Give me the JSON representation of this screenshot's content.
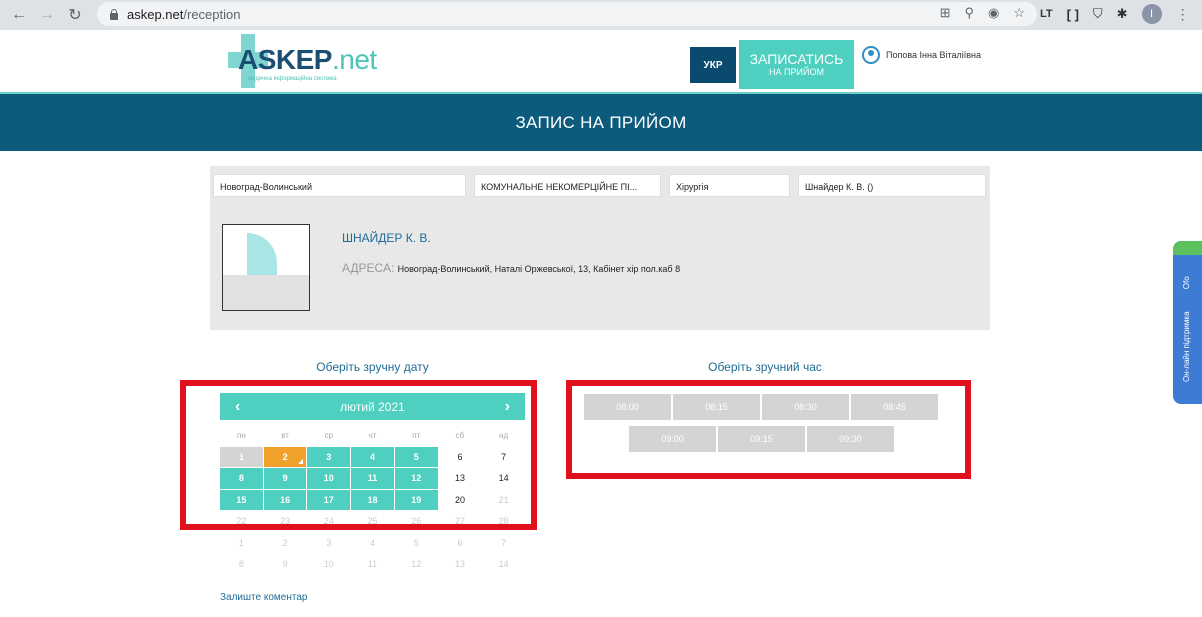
{
  "browser": {
    "url_host": "askep.net",
    "url_path": "/reception",
    "profile_initial": "I"
  },
  "header": {
    "logo_text": "ASKEP",
    "logo_net": ".net",
    "logo_tagline": "медична інформаційна система",
    "lang_label": "УКР",
    "book_label_line1": "ЗАПИСАТИСЬ",
    "book_label_line2": "НА ПРИЙОМ",
    "user_name": "Попова Інна Віталіївна"
  },
  "banner": {
    "title": "ЗАПИС НА ПРИЙОМ"
  },
  "filters": {
    "city": "Новоград-Волинський",
    "institution": "КОМУНАЛЬНЕ НЕКОМЕРЦІЙНЕ ПІ...",
    "specialty": "Хірургія",
    "doctor": "Шнайдер К. В. ()"
  },
  "doctor": {
    "name": "ШНАЙДЕР К. В.",
    "address_label": "АДРЕСА:",
    "address_value": "Новоград-Волинський, Наталі Оржевської, 13, Кабінет хір пол.каб 8"
  },
  "date_picker": {
    "label": "Оберіть зручну дату",
    "month": "лютий 2021",
    "prev_icon": "chevron-left-icon",
    "next_icon": "chevron-right-icon",
    "weekdays": [
      "пн",
      "вт",
      "ср",
      "чт",
      "пт",
      "сб",
      "нд"
    ],
    "weeks": [
      [
        {
          "d": "1",
          "s": "past"
        },
        {
          "d": "2",
          "s": "sel"
        },
        {
          "d": "3",
          "s": "avail"
        },
        {
          "d": "4",
          "s": "avail"
        },
        {
          "d": "5",
          "s": "avail"
        },
        {
          "d": "6",
          "s": "plain"
        },
        {
          "d": "7",
          "s": "plain"
        }
      ],
      [
        {
          "d": "8",
          "s": "avail"
        },
        {
          "d": "9",
          "s": "avail"
        },
        {
          "d": "10",
          "s": "avail"
        },
        {
          "d": "11",
          "s": "avail"
        },
        {
          "d": "12",
          "s": "avail"
        },
        {
          "d": "13",
          "s": "plain"
        },
        {
          "d": "14",
          "s": "plain"
        }
      ],
      [
        {
          "d": "15",
          "s": "avail"
        },
        {
          "d": "16",
          "s": "avail"
        },
        {
          "d": "17",
          "s": "avail"
        },
        {
          "d": "18",
          "s": "avail"
        },
        {
          "d": "19",
          "s": "avail"
        },
        {
          "d": "20",
          "s": "plain"
        },
        {
          "d": "21",
          "s": "dim"
        }
      ],
      [
        {
          "d": "22",
          "s": "dim"
        },
        {
          "d": "23",
          "s": "dim"
        },
        {
          "d": "24",
          "s": "dim"
        },
        {
          "d": "25",
          "s": "dim"
        },
        {
          "d": "26",
          "s": "dim"
        },
        {
          "d": "27",
          "s": "dim"
        },
        {
          "d": "28",
          "s": "dim"
        }
      ],
      [
        {
          "d": "1",
          "s": "dim"
        },
        {
          "d": "2",
          "s": "dim"
        },
        {
          "d": "3",
          "s": "dim"
        },
        {
          "d": "4",
          "s": "dim"
        },
        {
          "d": "5",
          "s": "dim"
        },
        {
          "d": "6",
          "s": "dim"
        },
        {
          "d": "7",
          "s": "dim"
        }
      ],
      [
        {
          "d": "8",
          "s": "dim"
        },
        {
          "d": "9",
          "s": "dim"
        },
        {
          "d": "10",
          "s": "dim"
        },
        {
          "d": "11",
          "s": "dim"
        },
        {
          "d": "12",
          "s": "dim"
        },
        {
          "d": "13",
          "s": "dim"
        },
        {
          "d": "14",
          "s": "dim"
        }
      ]
    ]
  },
  "time_picker": {
    "label": "Оберіть зручний час",
    "slots": [
      "08:00",
      "08:15",
      "08:30",
      "08:45",
      "09:00",
      "09:15",
      "09:30"
    ]
  },
  "comment": {
    "label": "Залиште коментар"
  },
  "support": {
    "text": "Он-лайн підтримка",
    "badge": "Ofo"
  },
  "colors": {
    "accent": "#4ecfbf",
    "brand_dark": "#0c5a7c",
    "selected": "#f0a12c",
    "highlight_red": "#e0101c"
  }
}
